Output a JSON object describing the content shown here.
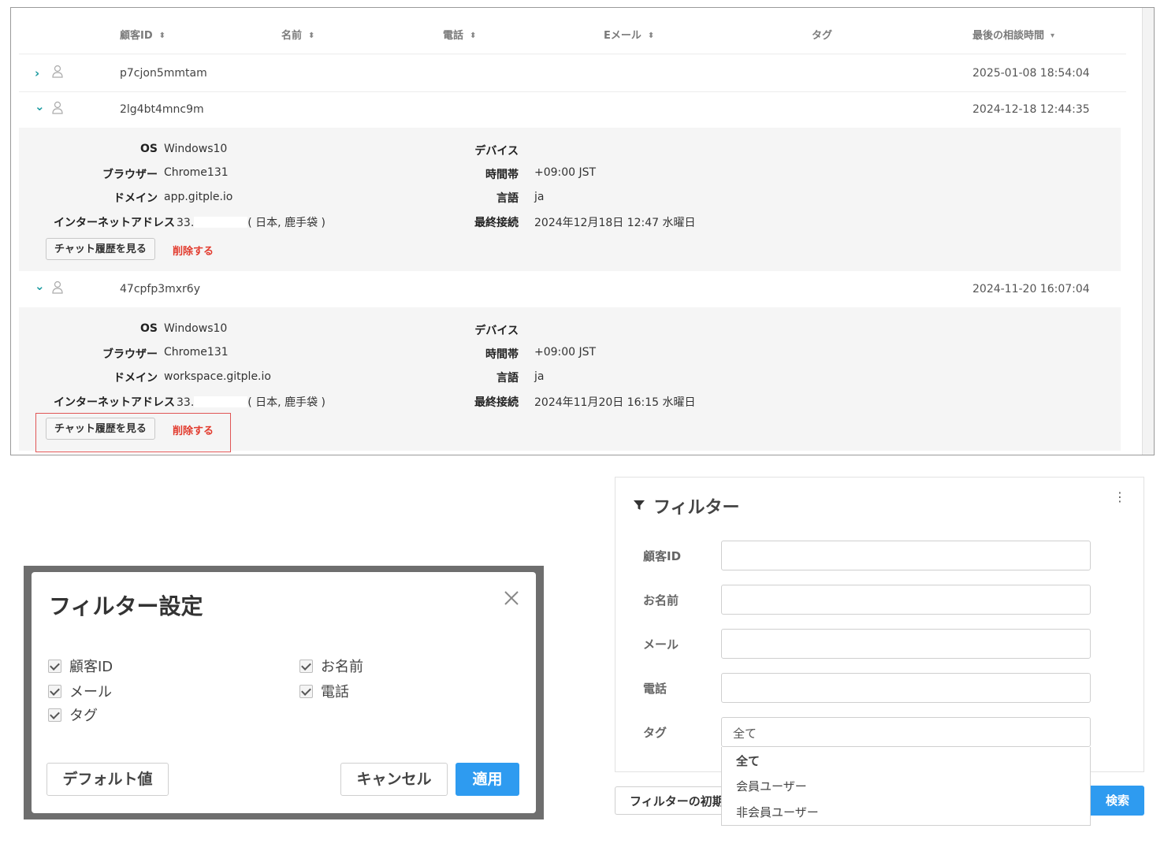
{
  "table": {
    "headers": [
      {
        "label": "顧客ID",
        "sort": "both"
      },
      {
        "label": "名前",
        "sort": "both"
      },
      {
        "label": "電話",
        "sort": "both"
      },
      {
        "label": "Eメール",
        "sort": "both"
      },
      {
        "label": "タグ",
        "sort": "none"
      },
      {
        "label": "最後の相談時間",
        "sort": "desc"
      }
    ],
    "sort_both_glyph": "⬍",
    "sort_desc_glyph": "▾",
    "rows": [
      {
        "id": "p7cjon5mmtam",
        "time": "2025-01-08 18:54:04",
        "expanded": false,
        "chevron": "›"
      },
      {
        "id": "2lg4bt4mnc9m",
        "time": "2024-12-18 12:44:35",
        "expanded": true,
        "chevron": "⌄"
      },
      {
        "id": "47cpfp3mxr6y",
        "time": "2024-11-20 16:07:04",
        "expanded": true,
        "chevron": "⌄"
      }
    ],
    "details": [
      {
        "os_label": "OS",
        "os": "Windows10",
        "browser_label": "ブラウザー",
        "browser": "Chrome131",
        "domain_label": "ドメイン",
        "domain": "app.gitple.io",
        "ip_label": "インターネットアドレス",
        "ip_prefix": "33.",
        "ip_location": "( 日本, 鹿手袋 )",
        "device_label": "デバイス",
        "device": "",
        "timezone_label": "時間帯",
        "timezone": "+09:00 JST",
        "lang_label": "言語",
        "lang": "ja",
        "last_label": "最終接続",
        "last": "2024年12月18日 12:47 水曜日",
        "history_btn": "チャット履歴を見る",
        "delete_btn": "削除する"
      },
      {
        "os_label": "OS",
        "os": "Windows10",
        "browser_label": "ブラウザー",
        "browser": "Chrome131",
        "domain_label": "ドメイン",
        "domain": "workspace.gitple.io",
        "ip_label": "インターネットアドレス",
        "ip_prefix": "33.",
        "ip_location": "( 日本, 鹿手袋 )",
        "device_label": "デバイス",
        "device": "",
        "timezone_label": "時間帯",
        "timezone": "+09:00 JST",
        "lang_label": "言語",
        "lang": "ja",
        "last_label": "最終接続",
        "last": "2024年11月20日 16:15 水曜日",
        "history_btn": "チャット履歴を見る",
        "delete_btn": "削除する"
      }
    ],
    "accent_color": "#1a9aa0",
    "delete_color": "#e23b2e"
  },
  "dialog": {
    "title": "フィルター設定",
    "checkboxes": [
      {
        "label": "顧客ID",
        "checked": true
      },
      {
        "label": "お名前",
        "checked": true
      },
      {
        "label": "メール",
        "checked": true
      },
      {
        "label": "電話",
        "checked": true
      },
      {
        "label": "タグ",
        "checked": true
      }
    ],
    "default_btn": "デフォルト値",
    "cancel_btn": "キャンセル",
    "apply_btn": "適用",
    "primary_color": "#2e9bf0"
  },
  "filter": {
    "title": "フィルター",
    "fields": [
      {
        "label": "顧客ID",
        "value": ""
      },
      {
        "label": "お名前",
        "value": ""
      },
      {
        "label": "メール",
        "value": ""
      },
      {
        "label": "電話",
        "value": ""
      }
    ],
    "tag_label": "タグ",
    "tag_selected": "全て",
    "tag_options": [
      "全て",
      "会員ユーザー",
      "非会員ユーザー"
    ],
    "reset_btn": "フィルターの初期化",
    "search_btn": "検索",
    "kebab_glyph": "⋮"
  }
}
